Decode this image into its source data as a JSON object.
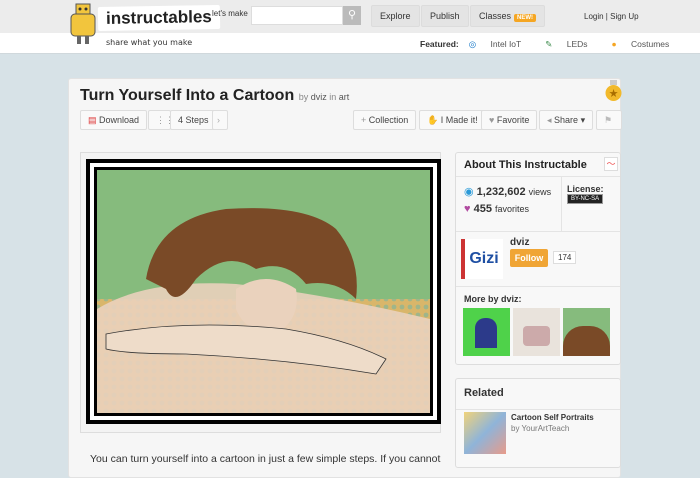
{
  "header": {
    "brand": "instructables",
    "tagline": "share what you make",
    "lets_make": "let's make",
    "search_placeholder": "",
    "nav": [
      "Explore",
      "Publish",
      "Classes"
    ],
    "new_badge": "NEW!",
    "login": "Login",
    "signup": "Sign Up",
    "featured_label": "Featured:",
    "featured": [
      "Intel IoT",
      "LEDs",
      "Costumes"
    ]
  },
  "article": {
    "title": "Turn Yourself Into a Cartoon",
    "by": "by",
    "author": "dviz",
    "in": "in",
    "category": "art",
    "intro": "You can turn yourself into a cartoon in just a few simple steps. If you cannot"
  },
  "toolbar": {
    "download": "Download",
    "steps": "4 Steps",
    "collection": "Collection",
    "made_it": "I Made it!",
    "favorite": "Favorite",
    "share": "Share"
  },
  "about": {
    "title": "About This Instructable",
    "views": "1,232,602",
    "views_label": "views",
    "favorites": "455",
    "favorites_label": "favorites",
    "license_label": "License:",
    "license": "BY-NC-SA",
    "author": "dviz",
    "follow": "Follow",
    "followers": "174",
    "more_by": "More by dviz:"
  },
  "related": {
    "title": "Related",
    "items": [
      {
        "title": "Cartoon Self Portraits",
        "by": "by YourArtTeach"
      }
    ]
  },
  "colors": {
    "accent": "#f5a623",
    "background": "#d7e2e7"
  }
}
